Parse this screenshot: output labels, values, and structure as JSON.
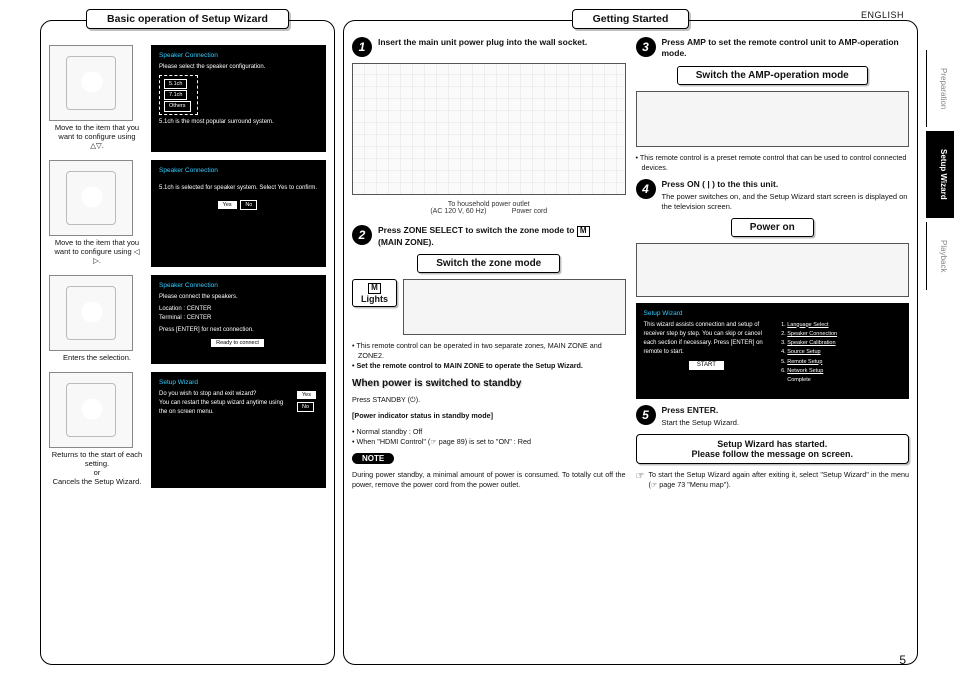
{
  "lang_label": "ENGLISH",
  "page_number": "5",
  "tabs": {
    "t1": "Preparation",
    "t2": "Setup Wizard",
    "t3": "Playback"
  },
  "left": {
    "title": "Basic operation of Setup Wizard",
    "cap1": "Move to the item that you want to configure using △▽.",
    "cap2": "Move to the item that you want to configure using ◁ ▷.",
    "cap3": "Enters the selection.",
    "cap4": "Returns to the start of each setting.\nor\nCancels the Setup Wizard.",
    "bb1_title": "Speaker Connection",
    "bb1_l1": "Please select the speaker configuration.",
    "bb1_opts": [
      "5.1ch",
      "7.1ch",
      "Others"
    ],
    "bb1_foot": "5.1ch is the most popular surround system.",
    "bb2_title": "Speaker Connection",
    "bb2_l1": "5.1ch is selected for speaker system. Select Yes to confirm.",
    "bb2_yes": "Yes",
    "bb2_no": "No",
    "bb3_title": "Speaker Connection",
    "bb3_l1": "Please connect the speakers.",
    "bb3_loc": "Location   : CENTER",
    "bb3_term": "Terminal  : CENTER",
    "bb3_enter": "Press [ENTER] for next connection.",
    "bb3_ready": "Ready to connect",
    "bb4_title": "Setup Wizard",
    "bb4_l1": "Do you wish to stop and exit wizard?\nYou can restart the setup wizard anytime using the on screen menu.",
    "bb4_yes": "Yes",
    "bb4_no": "No"
  },
  "right": {
    "title": "Getting Started",
    "step1": "Insert the main unit power plug into the wall socket.",
    "fig1_cap1": "To household power outlet",
    "fig1_cap2": "(AC 120 V, 60 Hz)",
    "fig1_cap3": "Power cord",
    "step2a": "Press ",
    "step2b": "ZONE SELECT",
    "step2c": " to switch the zone mode to ",
    "step2d": "(MAIN ZONE).",
    "zone_M": "M",
    "box_zone": "Switch the zone mode",
    "lights_M": "M",
    "lights_label": "Lights",
    "zone_note1": "This remote control can be operated in two separate zones, MAIN ZONE and ZONE2.",
    "zone_note2": "Set the remote control to MAIN ZONE to operate the Setup Wizard.",
    "standby_h": "When power is switched to standby",
    "standby_line": "Press STANDBY (⏻).",
    "pind_h": "[Power indicator status in standby mode]",
    "pind_b1": "Normal standby : Off",
    "pind_b2": "When \"HDMI Control\" (☞ page 89) is set to \"ON\" : Red",
    "note_label": "NOTE",
    "note_text": "During power standby, a minimal amount of power is consumed. To totally cut off the power, remove the power cord from the power outlet.",
    "step3a": "Press ",
    "step3b": "AMP",
    "step3c": " to set the remote control unit to AMP-operation mode.",
    "box_amp": "Switch the AMP-operation mode",
    "preset_note": "This remote control is a preset remote control that can be used to control connected devices.",
    "step4a": "Press ",
    "step4b": "ON ( | )",
    "step4c": " to the this unit.",
    "step4_sub": "The power switches on, and the Setup Wizard start screen is displayed on the television screen.",
    "box_power": "Power on",
    "wiz_title": "Setup Wizard",
    "wiz_text": "This wizard assists connection and setup of receiver step by step. You can skip or cancel each section if necessary. Press [ENTER] on remote to start.",
    "wiz_start": "START",
    "wiz_items": [
      "Language Select",
      "Speaker Connection",
      "Speaker Calibration",
      "Source Setup",
      "Remote Setup",
      "Network Setup"
    ],
    "wiz_complete": "Complete",
    "step5a": "Press ",
    "step5b": "ENTER.",
    "step5_sub": "Start the Setup Wizard.",
    "started1": "Setup Wizard has started.",
    "started2": "Please follow the message on screen.",
    "restart_tip": "To start the Setup Wizard again after exiting it, select \"Setup Wizard\" in the menu (☞ page 73 \"Menu map\")."
  }
}
